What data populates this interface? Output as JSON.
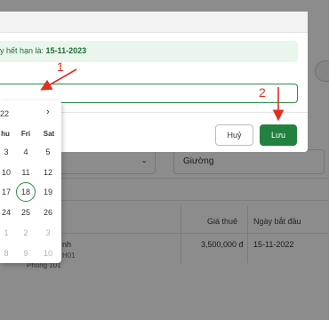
{
  "modal": {
    "notice_prefix": "y hết hạn là: ",
    "notice_date": "15-11-2023",
    "cancel_label": "Huỷ",
    "save_label": "Lưu"
  },
  "calendar": {
    "title": "22",
    "next_icon": "chevron-right-icon",
    "weekdays": [
      "hu",
      "Fri",
      "Sat"
    ],
    "rows": [
      [
        "3",
        "4",
        "5"
      ],
      [
        "10",
        "11",
        "12"
      ],
      [
        "17",
        "18",
        "19"
      ],
      [
        "24",
        "25",
        "26"
      ],
      [
        "1",
        "2",
        "3"
      ],
      [
        "8",
        "9",
        "10"
      ]
    ],
    "today": "18"
  },
  "background": {
    "bed_select": "Giường",
    "col_price": "Giá thuê",
    "col_start": "Ngày bắt đầu",
    "row_name": "nh",
    "row_sub1": "H01",
    "row_sub2": "Phòng 101",
    "row_price": "3,500,000 đ",
    "row_start": "15-11-2022"
  },
  "annotations": {
    "step1": "1",
    "step2": "2",
    "color": "#e0301e"
  },
  "colors": {
    "accent": "#238140",
    "notice_bg": "#eaf5ec"
  }
}
